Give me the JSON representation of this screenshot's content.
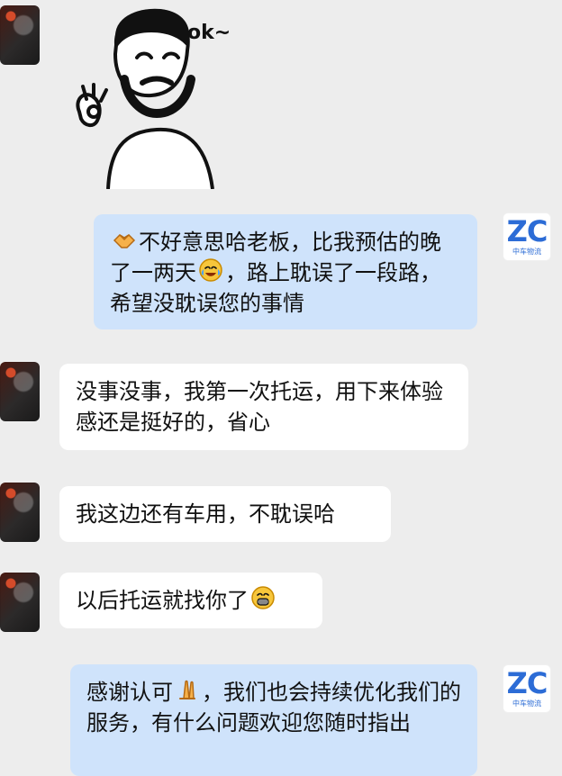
{
  "chat": {
    "sticker": {
      "text": "ok~"
    },
    "company_avatar": {
      "logo": "ZC",
      "subtitle": "中车物流"
    },
    "messages": [
      {
        "side": "right",
        "segments": [
          {
            "type": "emoji",
            "name": "handshake-icon"
          },
          {
            "type": "text",
            "text": "不好意思哈老板，比我预估的晚了一两天"
          },
          {
            "type": "emoji",
            "name": "tears-of-joy-icon"
          },
          {
            "type": "text",
            "text": "，路上耽误了一段路，希望没耽误您的事情"
          }
        ]
      },
      {
        "side": "left",
        "text": "没事没事，我第一次托运，用下来体验感还是挺好的，省心"
      },
      {
        "side": "left",
        "text": "我这边还有车用，不耽误哈"
      },
      {
        "side": "left",
        "segments": [
          {
            "type": "text",
            "text": "以后托运就找你了"
          },
          {
            "type": "emoji",
            "name": "grinning-face-icon"
          }
        ]
      },
      {
        "side": "right",
        "segments": [
          {
            "type": "text",
            "text": "感谢认可"
          },
          {
            "type": "emoji",
            "name": "praying-hands-icon"
          },
          {
            "type": "text",
            "text": "，我们也会持续优化我们的服务，有什么问题欢迎您随时指出"
          }
        ]
      }
    ]
  },
  "colors": {
    "background": "#ededed",
    "right_bubble": "#cfe3fb",
    "left_bubble": "#ffffff",
    "logo_blue": "#2c6cd6"
  }
}
